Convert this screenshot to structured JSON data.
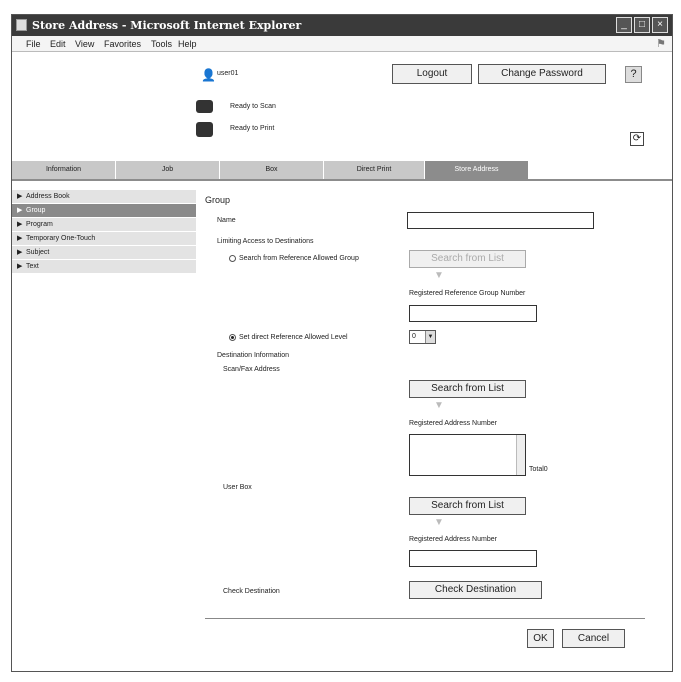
{
  "window": {
    "title": "Store Address - Microsoft Internet Explorer",
    "controls": [
      "_",
      "□",
      "×"
    ]
  },
  "menubar": [
    "File",
    "Edit",
    "View",
    "Favorites",
    "Tools",
    "Help"
  ],
  "header": {
    "user": "user01",
    "logout_label": "Logout",
    "change_password_label": "Change Password",
    "help_label": "?",
    "status_scan": "Ready to Scan",
    "status_print": "Ready to Print"
  },
  "tabs": [
    {
      "label": "Information",
      "active": false
    },
    {
      "label": "Job",
      "active": false
    },
    {
      "label": "Box",
      "active": false
    },
    {
      "label": "Direct Print",
      "active": false
    },
    {
      "label": "Store Address",
      "active": true
    }
  ],
  "sidebar": {
    "items": [
      {
        "label": "Address Book",
        "active": false
      },
      {
        "label": "Group",
        "active": true
      },
      {
        "label": "Program",
        "active": false
      },
      {
        "label": "Temporary One-Touch",
        "active": false
      },
      {
        "label": "Subject",
        "active": false
      },
      {
        "label": "Text",
        "active": false
      }
    ]
  },
  "form": {
    "heading": "Group",
    "name_label": "Name",
    "name_value": "",
    "limiting_label": "Limiting Access to Destinations",
    "radio_search_ref_label": "Search from Reference Allowed Group",
    "search_from_list_label": "Search from List",
    "registered_ref_group_label": "Registered Reference Group Number",
    "ref_group_value": "",
    "radio_set_direct_label": "Set direct Reference Allowed Level",
    "level_value": "0",
    "destination_info_label": "Destination Information",
    "scan_fax_label": "Scan/Fax Address",
    "registered_address_label": "Registered Address Number",
    "total_label": "Total0",
    "user_box_label": "User Box",
    "user_box_value": "",
    "check_destination_label": "Check Destination",
    "check_destination_button": "Check Destination",
    "ok_label": "OK",
    "cancel_label": "Cancel"
  }
}
